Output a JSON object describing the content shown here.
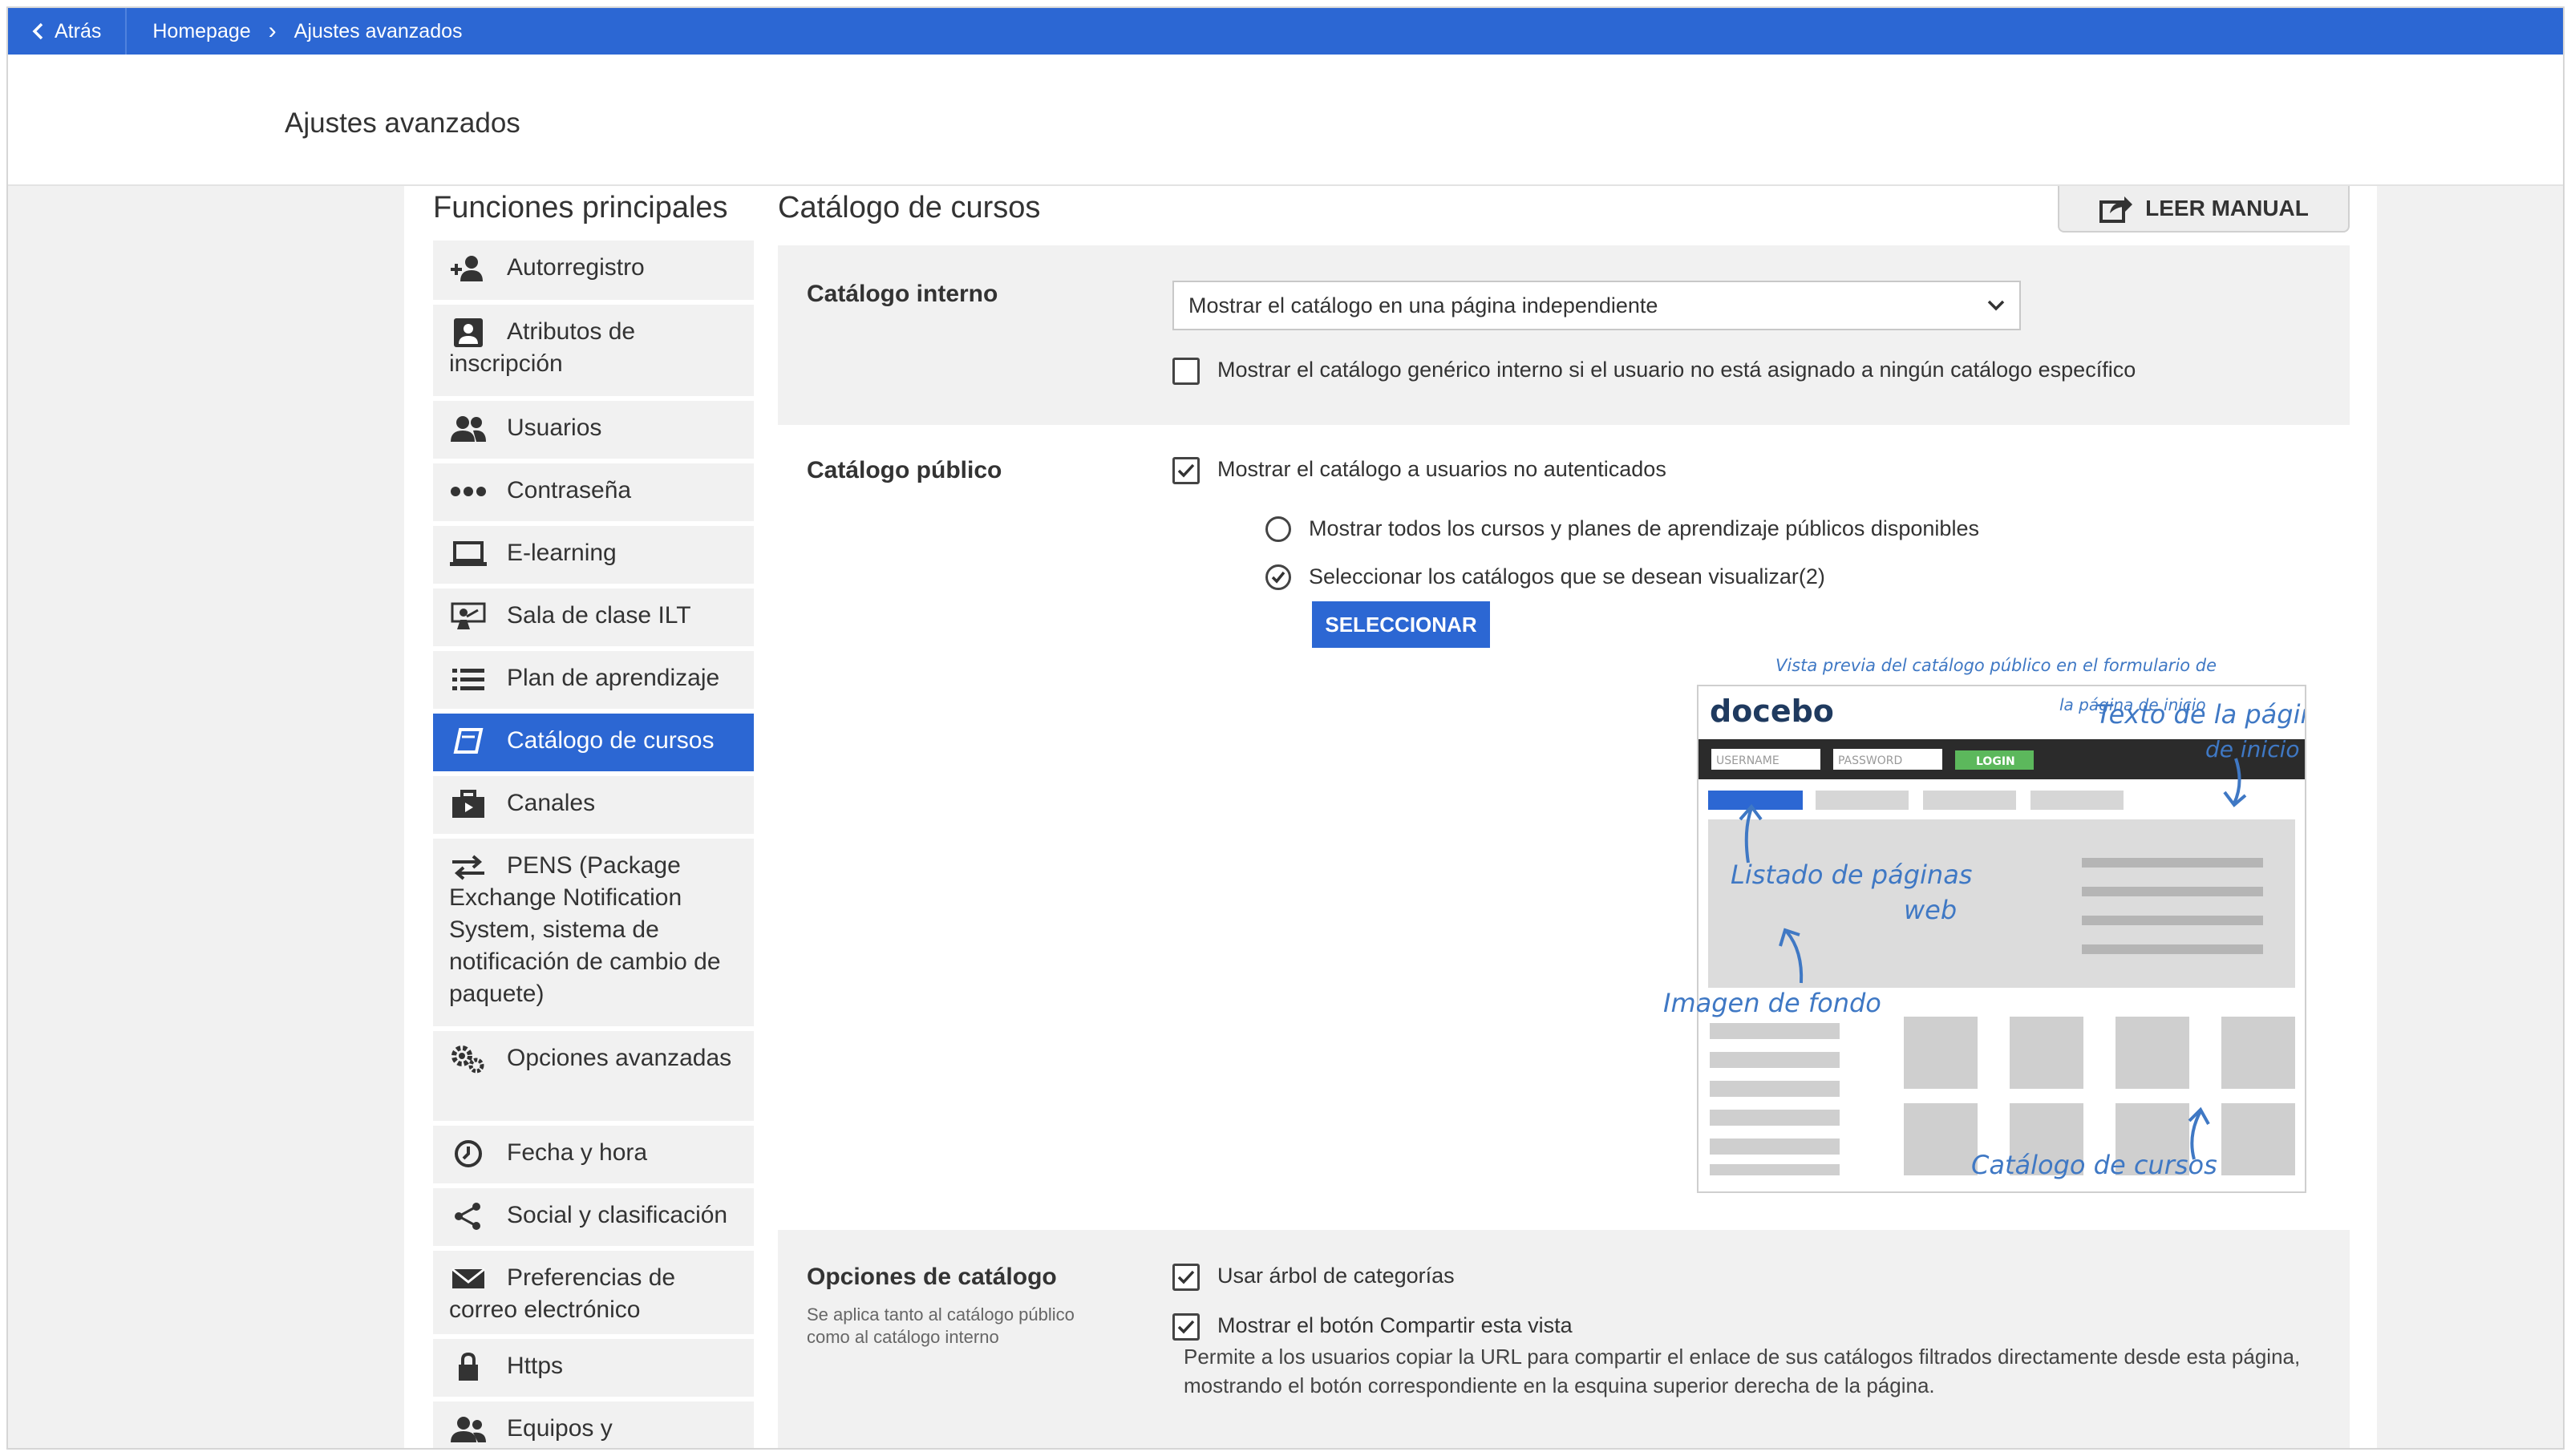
{
  "topbar": {
    "back_label": "Atrás",
    "breadcrumb": [
      "Homepage",
      "Ajustes avanzados"
    ]
  },
  "page": {
    "title": "Ajustes avanzados"
  },
  "sidebar": {
    "title": "Funciones principales",
    "items": [
      {
        "label": "Autorregistro",
        "icon": "user-plus-icon"
      },
      {
        "label": "Atributos de inscripción",
        "icon": "id-card-icon"
      },
      {
        "label": "Usuarios",
        "icon": "users-icon"
      },
      {
        "label": "Contraseña",
        "icon": "dots-icon"
      },
      {
        "label": "E-learning",
        "icon": "laptop-icon"
      },
      {
        "label": "Sala de clase ILT",
        "icon": "presenter-icon"
      },
      {
        "label": "Plan de aprendizaje",
        "icon": "list-icon"
      },
      {
        "label": "Catálogo de cursos",
        "icon": "book-icon",
        "active": true
      },
      {
        "label": "Canales",
        "icon": "briefcase-icon"
      },
      {
        "label": "PENS (Package Exchange Notification System, sistema de notificación de cambio de paquete)",
        "icon": "exchange-icon"
      },
      {
        "label": "Opciones avanzadas",
        "icon": "gears-icon"
      },
      {
        "label": "Fecha y hora",
        "icon": "clock-icon"
      },
      {
        "label": "Social y clasificación",
        "icon": "share-icon"
      },
      {
        "label": "Preferencias de correo electrónico",
        "icon": "envelope-icon"
      },
      {
        "label": "Https",
        "icon": "lock-icon"
      },
      {
        "label": "Equipos y",
        "icon": "team-icon"
      }
    ]
  },
  "main": {
    "title": "Catálogo de cursos",
    "manual_label": "LEER MANUAL",
    "internal": {
      "label": "Catálogo interno",
      "select_value": "Mostrar el catálogo en una página independiente",
      "checkbox_label": "Mostrar el catálogo genérico interno si el usuario no está asignado a ningún catálogo específico",
      "checkbox_checked": false
    },
    "public": {
      "label": "Catálogo público",
      "checkbox_label": "Mostrar el catálogo a usuarios no autenticados",
      "checkbox_checked": true,
      "radio_all": "Mostrar todos los cursos y planes de aprendizaje públicos disponibles",
      "radio_select": "Seleccionar los catálogos que se desean visualizar(2)",
      "selected_radio": "select",
      "select_button": "SELECCIONAR",
      "preview": {
        "caption_line1": "Vista previa del catálogo público en el formulario de",
        "caption_line2": "la página de inicio",
        "logo": "docebo",
        "username_placeholder": "USERNAME",
        "password_placeholder": "PASSWORD",
        "login_label": "LOGIN",
        "annot_text_line1": "Texto de la página",
        "annot_text_line2": "de inicio",
        "annot_list_line1": "Listado de páginas",
        "annot_list_line2": "web",
        "annot_bg": "Imagen de fondo",
        "annot_catalog": "Catálogo de cursos"
      }
    },
    "options": {
      "label": "Opciones de catálogo",
      "sub": "Se aplica tanto al catálogo público como al catálogo interno",
      "tree_label": "Usar árbol de categorías",
      "tree_checked": true,
      "share_label": "Mostrar el botón Compartir esta vista",
      "share_checked": true,
      "share_desc": "Permite a los usuarios copiar la URL para compartir el enlace de sus catálogos filtrados directamente desde esta página, mostrando el botón correspondiente en la esquina superior derecha de la página."
    }
  },
  "colors": {
    "brand": "#2c67d3",
    "annotation": "#3f78c4",
    "login_green": "#5cb85c",
    "panel": "#f1f1f1"
  }
}
